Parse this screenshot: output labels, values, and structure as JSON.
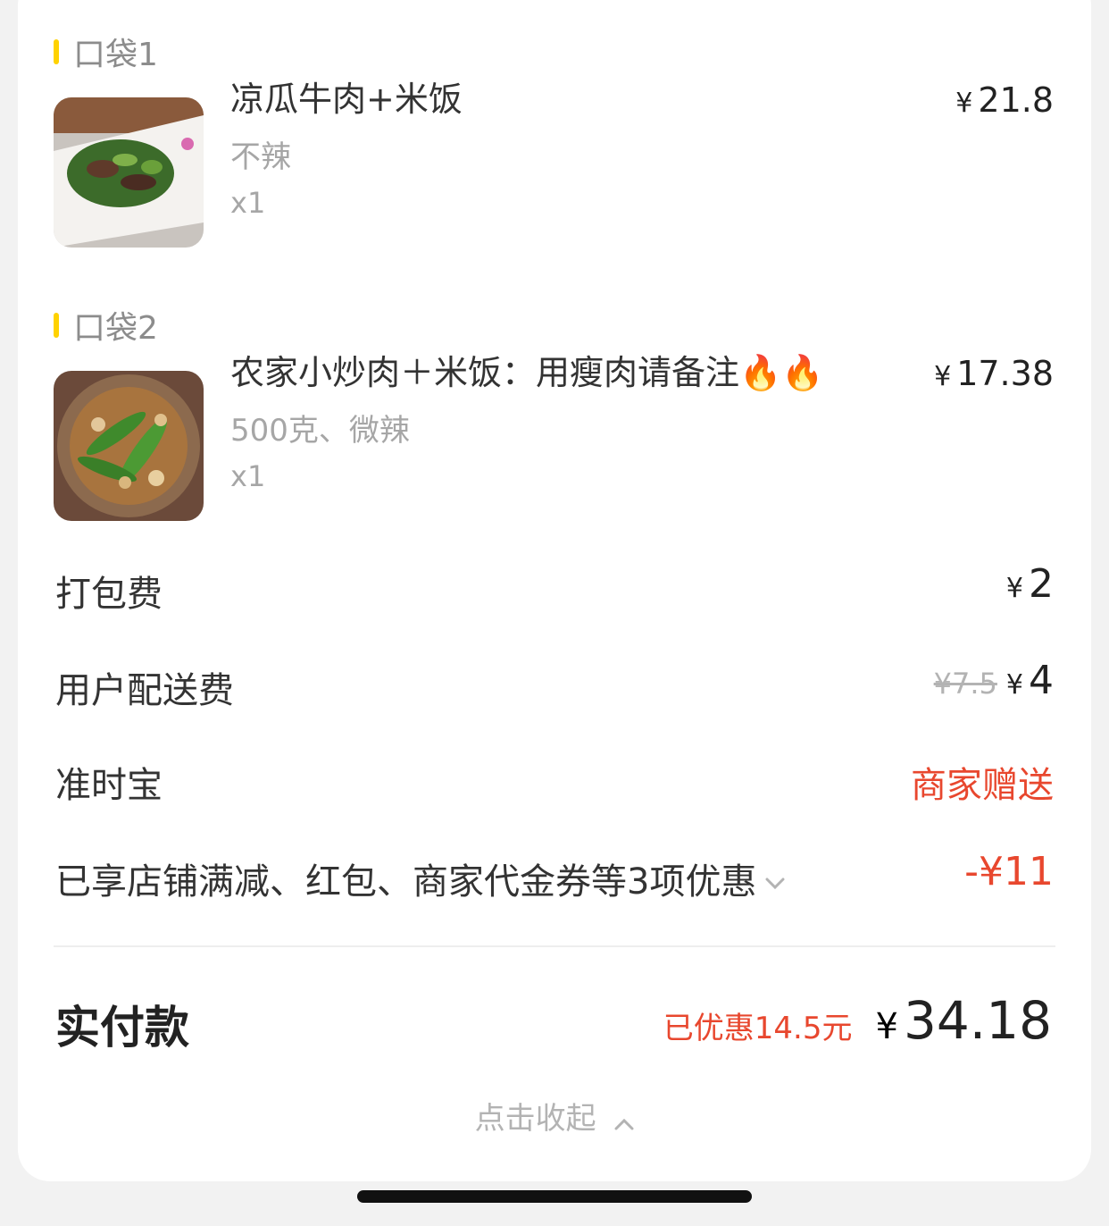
{
  "bags": [
    {
      "title": "口袋1",
      "item": {
        "name": "凉瓜牛肉+米饭",
        "spec": "不辣",
        "qty": "x1",
        "price": "21.8",
        "currency": "¥",
        "image": "bitter-melon-beef-photo"
      }
    },
    {
      "title": "口袋2",
      "item": {
        "name": "农家小炒肉＋米饭：用瘦肉请备注🔥🔥",
        "spec": "500克、微辣",
        "qty": "x1",
        "price": "17.38",
        "currency": "¥",
        "image": "stir-fried-pork-pepper-photo"
      }
    }
  ],
  "fees": {
    "packing": {
      "label": "打包费",
      "currency": "¥",
      "value": "2"
    },
    "delivery": {
      "label": "用户配送费",
      "original": "¥7.5",
      "currency": "¥",
      "value": "4"
    },
    "ontime": {
      "label": "准时宝",
      "value": "商家赠送"
    },
    "discount": {
      "label": "已享店铺满减、红包、商家代金券等3项优惠",
      "value": "-¥11"
    }
  },
  "total": {
    "label": "实付款",
    "saved": "已优惠14.5元",
    "currency": "¥",
    "amount": "34.18"
  },
  "collapse_label": "点击收起",
  "colors": {
    "accent_yellow": "#ffd200",
    "discount_red": "#e8472e",
    "text_dark": "#222222",
    "text_muted": "#a6a6a6"
  },
  "icons": {
    "expand": "chevron-down-icon",
    "collapse": "chevron-up-icon"
  }
}
